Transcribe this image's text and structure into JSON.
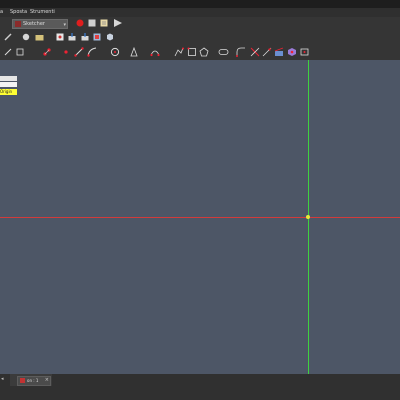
{
  "menubar": {
    "items": [
      "a",
      "Sposta",
      "Strumenti"
    ]
  },
  "toolbar": {
    "workbench_combo": "Sketcher"
  },
  "tree": {
    "items": [
      "",
      "",
      "Origin"
    ]
  },
  "document_tab": {
    "label": "on : 1"
  },
  "colors": {
    "x_axis": "#d23b3b",
    "y_axis": "#3fd13f",
    "origin_highlight": "#ffff33",
    "viewport_bg": "#4d5666"
  }
}
